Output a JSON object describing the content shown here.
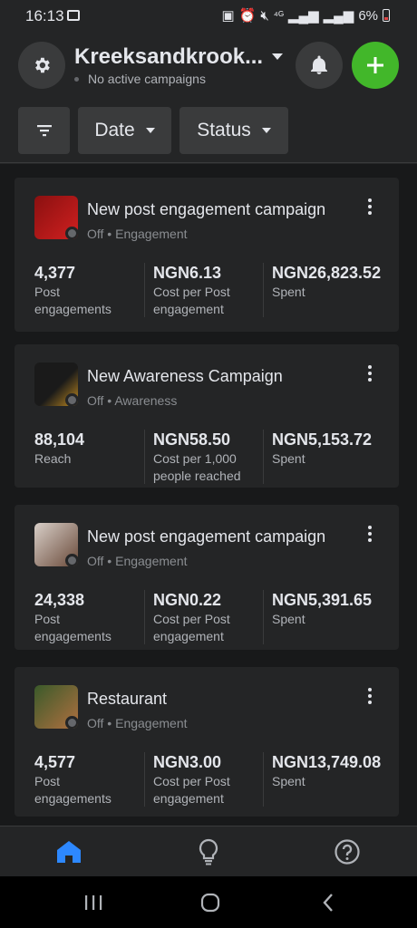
{
  "status_bar": {
    "time": "16:13",
    "battery": "6%"
  },
  "header": {
    "account_name": "Kreeksandkrook...",
    "account_status": "No active campaigns",
    "filters": {
      "date_label": "Date",
      "status_label": "Status"
    }
  },
  "campaigns": [
    {
      "title": "New post engagement campaign",
      "status": "Off",
      "objective": "Engagement",
      "thumb_colors": [
        "#8a1010",
        "#d02020"
      ],
      "metrics": [
        {
          "value": "4,377",
          "label": "Post engagements"
        },
        {
          "value": "NGN6.13",
          "label": "Cost per Post engagement"
        },
        {
          "value": "NGN26,823.52",
          "label": "Spent"
        }
      ]
    },
    {
      "title": "New Awareness Campaign",
      "status": "Off",
      "objective": "Awareness",
      "thumb_colors": [
        "#1a1a1a",
        "#c08a20"
      ],
      "metrics": [
        {
          "value": "88,104",
          "label": "Reach"
        },
        {
          "value": "NGN58.50",
          "label": "Cost per 1,000 people reached"
        },
        {
          "value": "NGN5,153.72",
          "label": "Spent"
        }
      ]
    },
    {
      "title": "New post engagement campaign",
      "status": "Off",
      "objective": "Engagement",
      "thumb_colors": [
        "#d8cfc8",
        "#6a4a3a"
      ],
      "metrics": [
        {
          "value": "24,338",
          "label": "Post engagements"
        },
        {
          "value": "NGN0.22",
          "label": "Cost per Post engagement"
        },
        {
          "value": "NGN5,391.65",
          "label": "Spent"
        }
      ]
    },
    {
      "title": "Restaurant",
      "status": "Off",
      "objective": "Engagement",
      "thumb_colors": [
        "#3a5a2a",
        "#b07040"
      ],
      "metrics": [
        {
          "value": "4,577",
          "label": "Post engagements"
        },
        {
          "value": "NGN3.00",
          "label": "Cost per Post engagement"
        },
        {
          "value": "NGN13,749.08",
          "label": "Spent"
        }
      ]
    }
  ],
  "bottom_nav": {
    "items": [
      {
        "icon": "home-icon",
        "active": true
      },
      {
        "icon": "lightbulb-icon",
        "active": false
      },
      {
        "icon": "help-icon",
        "active": false
      }
    ]
  },
  "colors": {
    "accent_green": "#42b72a",
    "active_blue": "#2d88ff"
  }
}
